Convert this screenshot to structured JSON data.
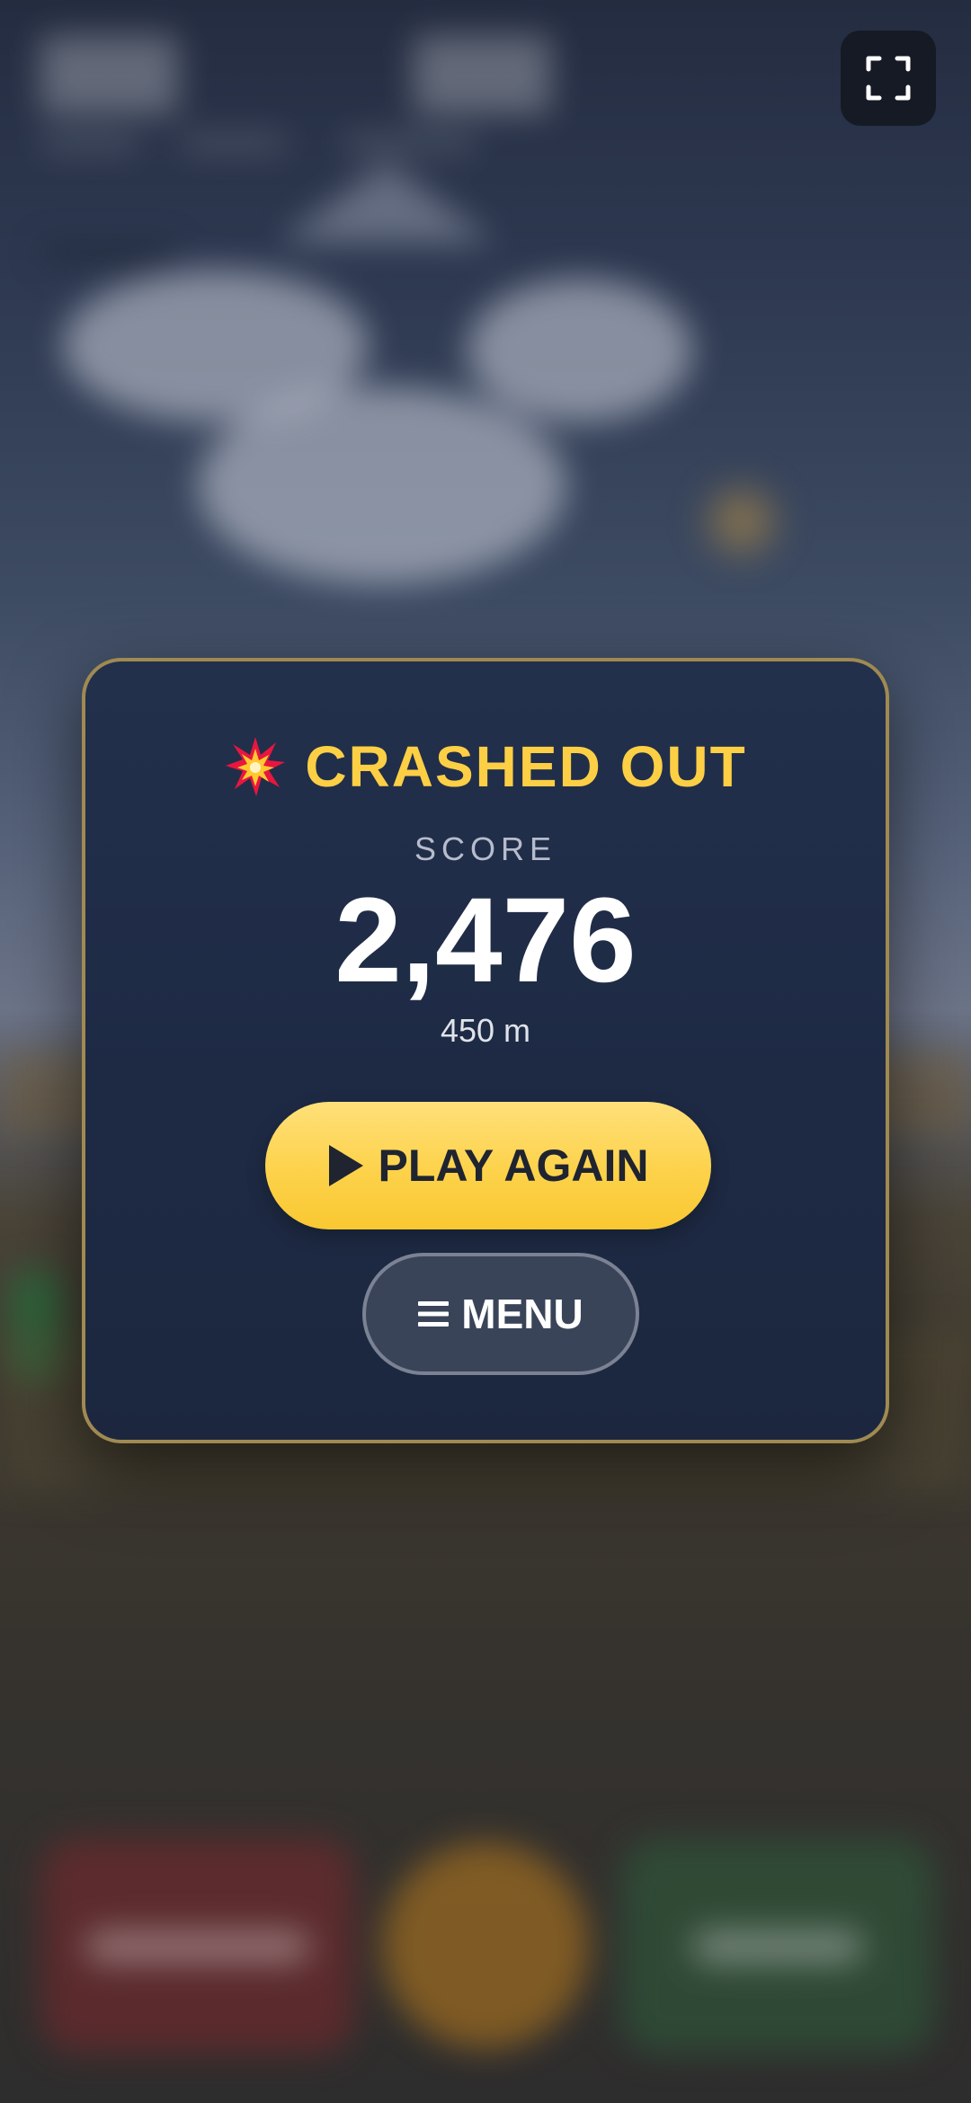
{
  "game_over": {
    "title": "CRASHED OUT",
    "title_icon": "explosion-icon",
    "score_label": "SCORE",
    "score_value": "2,476",
    "distance": "450 m"
  },
  "buttons": {
    "play_again": {
      "label": "PLAY AGAIN",
      "icon": "play-icon"
    },
    "menu": {
      "label": "MENU",
      "icon": "hamburger-icon"
    },
    "fullscreen": {
      "icon": "fullscreen-icon"
    }
  },
  "colors": {
    "accent_gold": "#fccf45",
    "card_border": "#a08a52",
    "card_background": "#22304c",
    "play_button": "#fdd24a",
    "menu_button": "#3a4458"
  }
}
